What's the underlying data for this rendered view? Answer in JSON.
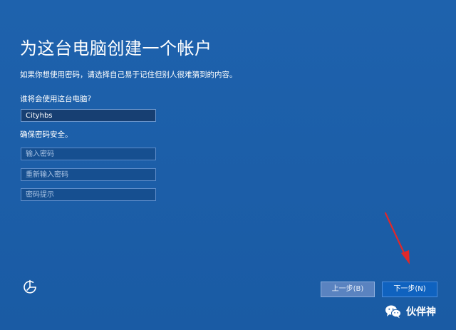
{
  "setup": {
    "title": "为这台电脑创建一个帐户",
    "subtitle": "如果你想使用密码，请选择自己易于记住但别人很难猜到的内容。",
    "name_question": "谁将会使用这台电脑?",
    "username_value": "Cityhbs",
    "security_label": "确保密码安全。",
    "password_placeholder": "输入密码",
    "repeat_placeholder": "重新输入密码",
    "hint_placeholder": "密码提示"
  },
  "buttons": {
    "back_label": "上一步(B)",
    "next_label": "下一步(N)"
  },
  "watermark": {
    "text": "伙伴神"
  },
  "icons": {
    "accessibility": "ease-of-access-icon",
    "wechat": "wechat-icon",
    "annotation": "red-arrow"
  },
  "colors": {
    "background": "#1d5ea8",
    "field": "#164f90",
    "next_button": "#0f62bf",
    "back_button": "#5a83c0",
    "arrow": "#e0282a"
  }
}
